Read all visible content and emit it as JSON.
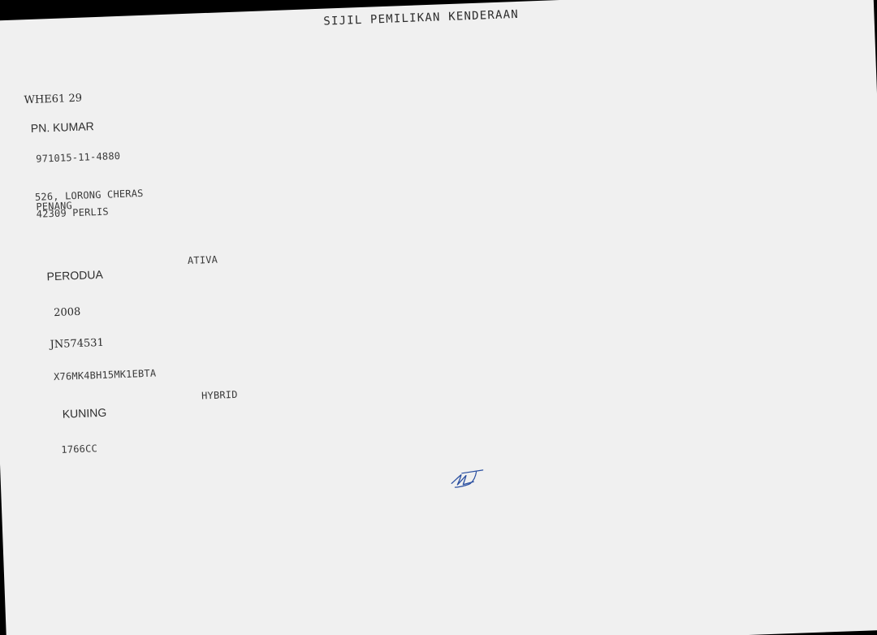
{
  "document": {
    "title": "SIJIL PEMILIKAN KENDERAAN",
    "registration_no": "WHE61 29",
    "owner_name": "PN. KUMAR",
    "ic_number": "971015-11-4880",
    "address": {
      "line1": "526, LORONG CHERAS",
      "line2": "PENANG",
      "line3": "42309 PERLIS"
    },
    "vehicle": {
      "make": "PERODUA",
      "model": "ATIVA",
      "year": "2008",
      "engine_no": "JN574531",
      "chassis_no": "X76MK4BH15MK1EBTA",
      "color": "KUNING",
      "fuel": "HYBRID",
      "capacity": "1766CC"
    },
    "ink_color": "#2a4fa0"
  }
}
